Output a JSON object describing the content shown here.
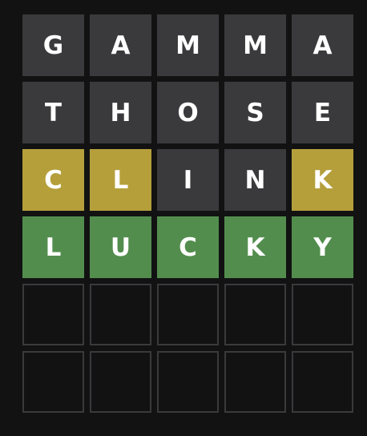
{
  "colors": {
    "background": "#121213",
    "absent": "#3a3a3c",
    "present": "#b59f3b",
    "correct": "#538d4e",
    "empty_border": "#3a3a3c",
    "text": "#ffffff"
  },
  "board": {
    "rows": [
      {
        "tiles": [
          {
            "letter": "G",
            "state": "absent"
          },
          {
            "letter": "A",
            "state": "absent"
          },
          {
            "letter": "M",
            "state": "absent"
          },
          {
            "letter": "M",
            "state": "absent"
          },
          {
            "letter": "A",
            "state": "absent"
          }
        ]
      },
      {
        "tiles": [
          {
            "letter": "T",
            "state": "absent"
          },
          {
            "letter": "H",
            "state": "absent"
          },
          {
            "letter": "O",
            "state": "absent"
          },
          {
            "letter": "S",
            "state": "absent"
          },
          {
            "letter": "E",
            "state": "absent"
          }
        ]
      },
      {
        "tiles": [
          {
            "letter": "C",
            "state": "present"
          },
          {
            "letter": "L",
            "state": "present"
          },
          {
            "letter": "I",
            "state": "absent"
          },
          {
            "letter": "N",
            "state": "absent"
          },
          {
            "letter": "K",
            "state": "present"
          }
        ]
      },
      {
        "tiles": [
          {
            "letter": "L",
            "state": "correct"
          },
          {
            "letter": "U",
            "state": "correct"
          },
          {
            "letter": "C",
            "state": "correct"
          },
          {
            "letter": "K",
            "state": "correct"
          },
          {
            "letter": "Y",
            "state": "correct"
          }
        ]
      },
      {
        "tiles": [
          {
            "letter": "",
            "state": "empty"
          },
          {
            "letter": "",
            "state": "empty"
          },
          {
            "letter": "",
            "state": "empty"
          },
          {
            "letter": "",
            "state": "empty"
          },
          {
            "letter": "",
            "state": "empty"
          }
        ]
      },
      {
        "tiles": [
          {
            "letter": "",
            "state": "empty"
          },
          {
            "letter": "",
            "state": "empty"
          },
          {
            "letter": "",
            "state": "empty"
          },
          {
            "letter": "",
            "state": "empty"
          },
          {
            "letter": "",
            "state": "empty"
          }
        ]
      }
    ]
  }
}
